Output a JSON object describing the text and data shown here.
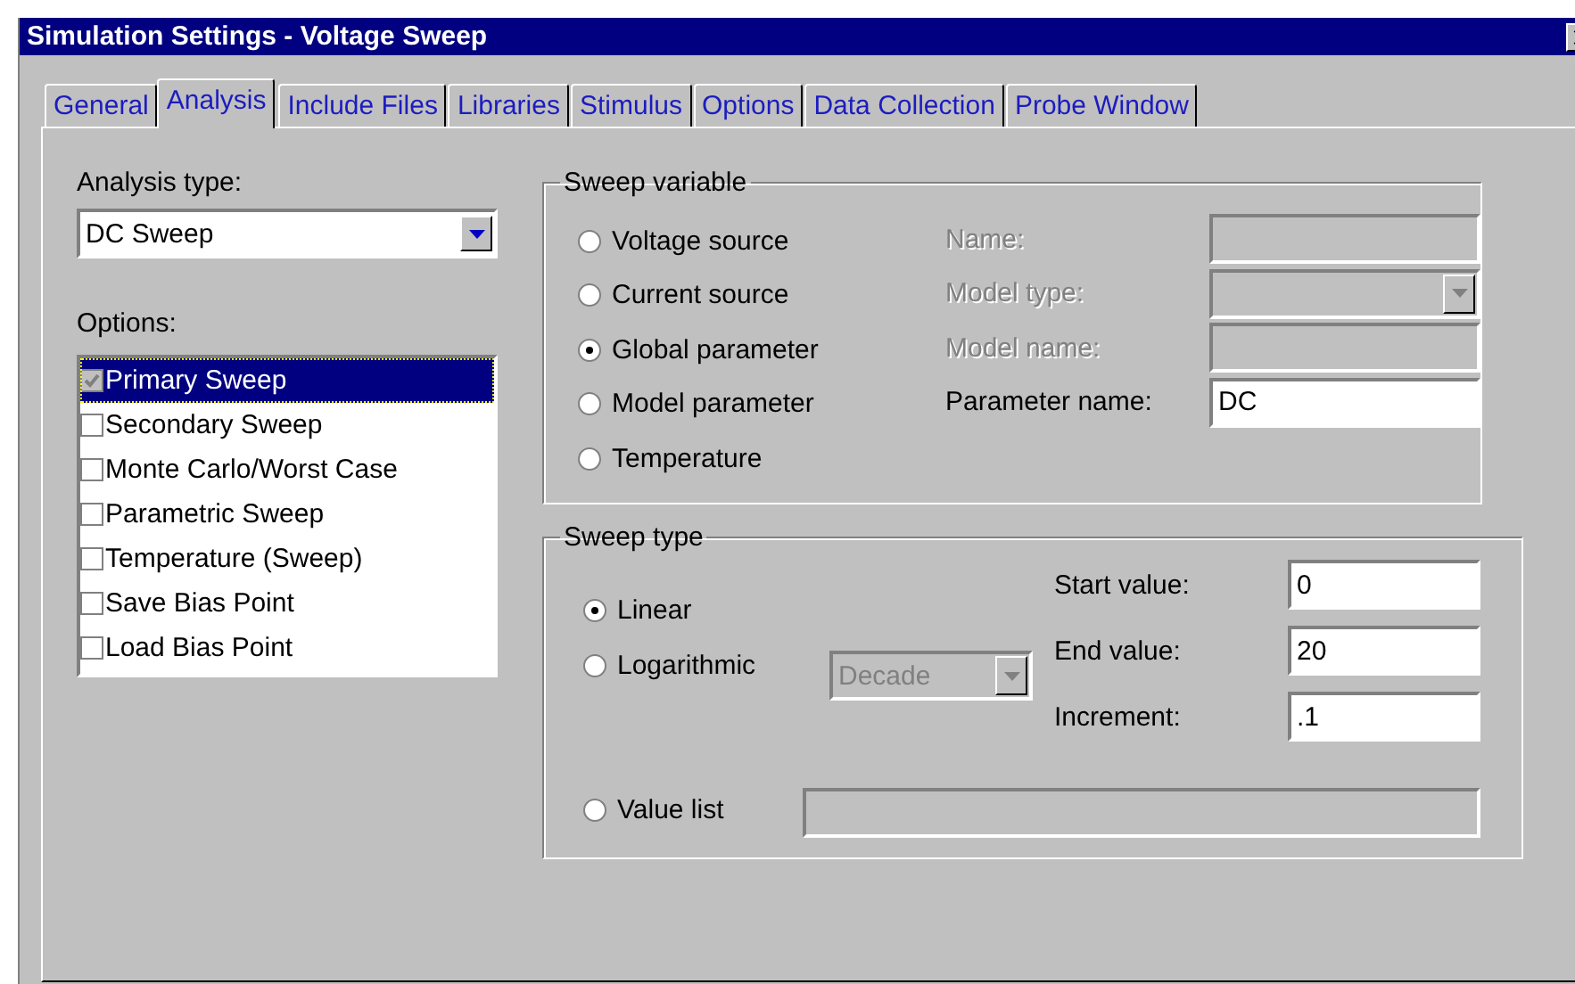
{
  "window": {
    "title": "Simulation Settings - Voltage Sweep"
  },
  "tabs": [
    {
      "label": "General",
      "selected": false
    },
    {
      "label": "Analysis",
      "selected": true
    },
    {
      "label": "Include Files",
      "selected": false
    },
    {
      "label": "Libraries",
      "selected": false
    },
    {
      "label": "Stimulus",
      "selected": false
    },
    {
      "label": "Options",
      "selected": false
    },
    {
      "label": "Data Collection",
      "selected": false
    },
    {
      "label": "Probe Window",
      "selected": false
    }
  ],
  "analysis_type": {
    "label": "Analysis type:",
    "value": "DC Sweep"
  },
  "options": {
    "label": "Options:",
    "items": [
      {
        "label": "Primary Sweep",
        "checked": true,
        "selected": true
      },
      {
        "label": "Secondary Sweep",
        "checked": false,
        "selected": false
      },
      {
        "label": "Monte Carlo/Worst Case",
        "checked": false,
        "selected": false
      },
      {
        "label": "Parametric Sweep",
        "checked": false,
        "selected": false
      },
      {
        "label": "Temperature (Sweep)",
        "checked": false,
        "selected": false
      },
      {
        "label": "Save Bias Point",
        "checked": false,
        "selected": false
      },
      {
        "label": "Load Bias Point",
        "checked": false,
        "selected": false
      }
    ]
  },
  "sweep_variable": {
    "title": "Sweep variable",
    "choices": [
      {
        "label": "Voltage source",
        "selected": false
      },
      {
        "label": "Current source",
        "selected": false
      },
      {
        "label": "Global parameter",
        "selected": true
      },
      {
        "label": "Model parameter",
        "selected": false
      },
      {
        "label": "Temperature",
        "selected": false
      }
    ],
    "fields": [
      {
        "label": "Name:",
        "kind": "text",
        "disabled": true
      },
      {
        "label": "Model type:",
        "kind": "dropdown",
        "disabled": true
      },
      {
        "label": "Model name:",
        "kind": "text",
        "disabled": true
      },
      {
        "label": "Parameter name:",
        "kind": "text",
        "disabled": false,
        "value": "DC"
      }
    ]
  },
  "sweep_type": {
    "title": "Sweep type",
    "linear": {
      "label": "Linear",
      "selected": true
    },
    "logarithmic": {
      "label": "Logarithmic",
      "selected": false,
      "scale": {
        "value": "Decade",
        "disabled": true
      }
    },
    "value_list": {
      "label": "Value list",
      "selected": false,
      "disabled": true
    },
    "fields": [
      {
        "label": "Start value:",
        "value": "0"
      },
      {
        "label": "End value:",
        "value": "20"
      },
      {
        "label": "Increment:",
        "value": ".1"
      }
    ]
  }
}
